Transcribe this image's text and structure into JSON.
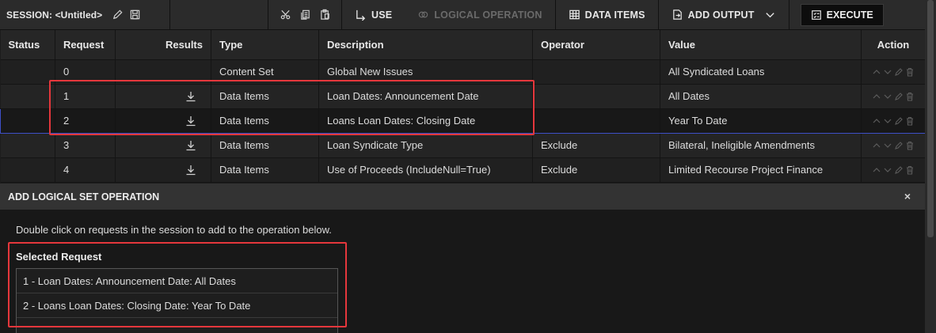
{
  "toolbar": {
    "session_title": "SESSION: <Untitled>",
    "use_label": "USE",
    "logical_label": "LOGICAL OPERATION",
    "data_items_label": "DATA ITEMS",
    "add_output_label": "ADD OUTPUT",
    "execute_label": "EXECUTE"
  },
  "table": {
    "headers": [
      "Status",
      "Request",
      "Results",
      "Type",
      "Description",
      "Operator",
      "Value",
      "Action"
    ],
    "rows": [
      {
        "request": "0",
        "type": "Content Set",
        "description": "Global New Issues",
        "operator": "",
        "value": "All Syndicated Loans",
        "has_download": false
      },
      {
        "request": "1",
        "type": "Data Items",
        "description": "Loan Dates: Announcement Date",
        "operator": "",
        "value": "All Dates",
        "has_download": true
      },
      {
        "request": "2",
        "type": "Data Items",
        "description": "Loans Loan Dates: Closing Date",
        "operator": "",
        "value": "Year To Date",
        "has_download": true
      },
      {
        "request": "3",
        "type": "Data Items",
        "description": "Loan Syndicate Type",
        "operator": "Exclude",
        "value": "Bilateral, Ineligible Amendments",
        "has_download": true
      },
      {
        "request": "4",
        "type": "Data Items",
        "description": "Use of Proceeds (IncludeNull=True)",
        "operator": "Exclude",
        "value": "Limited Recourse Project Finance",
        "has_download": true
      }
    ]
  },
  "panel": {
    "title": "ADD LOGICAL SET OPERATION",
    "close": "×",
    "instruction": "Double click on requests in the session to add to the operation below.",
    "selected_label": "Selected Request",
    "selected_items": [
      "1 - Loan Dates: Announcement Date: All Dates",
      "2 - Loans Loan Dates: Closing Date: Year To Date"
    ]
  },
  "colors": {
    "highlight": "#e5373c",
    "selection_border": "#3d4fc7"
  }
}
